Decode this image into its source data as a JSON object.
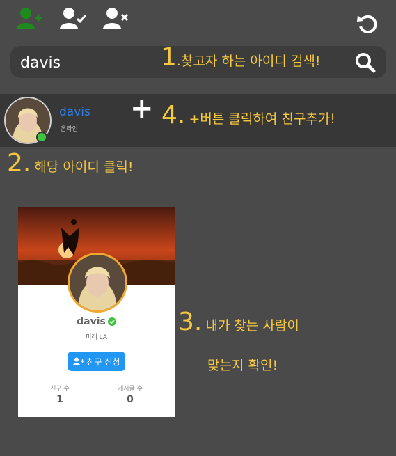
{
  "toolbar": {
    "add_friend_icon": "user-plus-icon",
    "accepted_icon": "user-check-icon",
    "remove_icon": "user-x-icon",
    "refresh_icon": "refresh-icon",
    "active_color": "#1e8a1e"
  },
  "search": {
    "value": "davis",
    "placeholder": "",
    "icon": "search-icon"
  },
  "annotations": {
    "step1_num": "1",
    "step1_text": ".찾고자 하는 아이디 검색!",
    "step2_num": "2.",
    "step2_text": "해당 아이디 클릭!",
    "step3_num": "3.",
    "step3_text_line1": "내가 찾는 사람이",
    "step3_text_line2": "맞는지 확인!",
    "step4_num": "4.",
    "step4_text": "+버튼 클릭하여 친구추가!"
  },
  "result": {
    "username": "davis",
    "status": "온라인",
    "add_symbol": "+"
  },
  "profile_card": {
    "username": "davis",
    "location": "미래 LA",
    "friend_request_label": "친구 신청",
    "friends_label": "친구 수",
    "friends_count": "1",
    "posts_label": "게시글 수",
    "posts_count": "0",
    "accent_color": "#2196f3",
    "verified_color": "#3ec43e"
  }
}
